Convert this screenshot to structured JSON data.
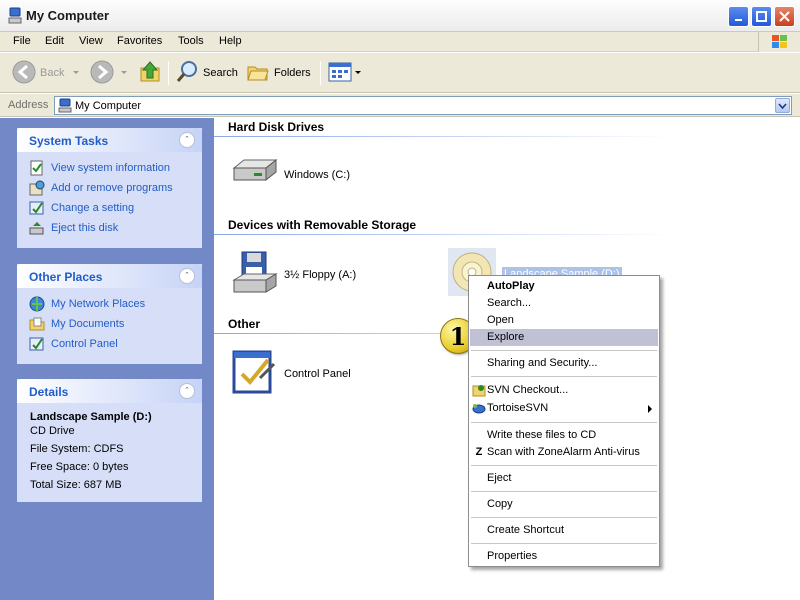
{
  "window": {
    "title": "My Computer"
  },
  "menubar": {
    "items": [
      "File",
      "Edit",
      "View",
      "Favorites",
      "Tools",
      "Help"
    ]
  },
  "toolbar": {
    "back": "Back",
    "search": "Search",
    "folders": "Folders"
  },
  "address": {
    "label": "Address",
    "value": "My Computer"
  },
  "system_tasks": {
    "title": "System Tasks",
    "items": [
      "View system information",
      "Add or remove programs",
      "Change a setting",
      "Eject this disk"
    ]
  },
  "other_places": {
    "title": "Other Places",
    "items": [
      "My Network Places",
      "My Documents",
      "Control Panel"
    ]
  },
  "details": {
    "title": "Details",
    "name": "Landscape Sample (D:)",
    "lines": [
      "CD Drive",
      "File System: CDFS",
      "Free Space: 0 bytes",
      "Total Size: 687 MB"
    ]
  },
  "groups": {
    "hard_disks": "Hard Disk Drives",
    "removable": "Devices with Removable Storage",
    "other": "Other"
  },
  "drives": {
    "c": "Windows (C:)",
    "floppy": "3½ Floppy (A:)",
    "d": "Landscape Sample (D:)",
    "control_panel": "Control Panel"
  },
  "context_menu": {
    "items": [
      "AutoPlay",
      "Search...",
      "Open",
      "Explore",
      "Sharing and Security...",
      "SVN Checkout...",
      "TortoiseSVN",
      "Write these files to CD",
      "Scan with ZoneAlarm Anti-virus",
      "Eject",
      "Copy",
      "Create Shortcut",
      "Properties"
    ],
    "highlighted": "Explore"
  },
  "step_badge": "1",
  "colors": {
    "link": "#215dc6",
    "pane": "#7388c7",
    "highlight": "#c1c1d6"
  }
}
